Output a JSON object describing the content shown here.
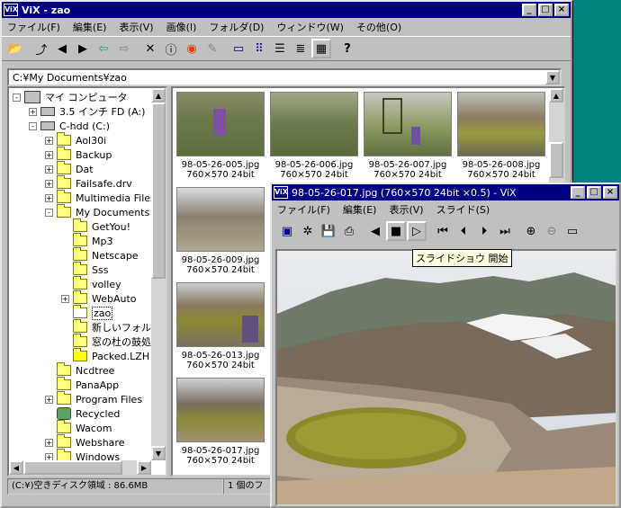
{
  "main_window": {
    "title": "ViX - zao",
    "app_icon": "ViX",
    "menu": [
      "ファイル(F)",
      "編集(E)",
      "表示(V)",
      "画像(I)",
      "フォルダ(D)",
      "ウィンドウ(W)",
      "その他(O)"
    ],
    "toolbar_icons": [
      "open-folder-icon",
      "up-folder-icon",
      "prev-icon",
      "next-icon",
      "back-icon",
      "forward-icon",
      "delete-icon",
      "info-icon",
      "color-icon",
      "tool-icon",
      "view-large-icon",
      "view-small-icon",
      "view-list-icon",
      "view-detail-icon",
      "view-thumbnail-icon",
      "help-icon"
    ],
    "path": "C:¥My Documents¥zao"
  },
  "tree": {
    "nodes": [
      {
        "label": "マイ コンピュータ",
        "level": 0,
        "expander": "-",
        "icon": "pc"
      },
      {
        "label": "3.5 インチ FD (A:)",
        "level": 1,
        "expander": "+",
        "icon": "drive"
      },
      {
        "label": "C-hdd (C:)",
        "level": 1,
        "expander": "-",
        "icon": "drive"
      },
      {
        "label": "Aol30i",
        "level": 2,
        "expander": "+",
        "icon": "folder"
      },
      {
        "label": "Backup",
        "level": 2,
        "expander": "+",
        "icon": "folder"
      },
      {
        "label": "Dat",
        "level": 2,
        "expander": "+",
        "icon": "folder"
      },
      {
        "label": "Failsafe.drv",
        "level": 2,
        "expander": "+",
        "icon": "folder"
      },
      {
        "label": "Multimedia Files",
        "level": 2,
        "expander": "+",
        "icon": "folder"
      },
      {
        "label": "My Documents",
        "level": 2,
        "expander": "-",
        "icon": "folder"
      },
      {
        "label": "GetYou!",
        "level": 3,
        "expander": "",
        "icon": "folder"
      },
      {
        "label": "Mp3",
        "level": 3,
        "expander": "",
        "icon": "folder"
      },
      {
        "label": "Netscape",
        "level": 3,
        "expander": "",
        "icon": "folder"
      },
      {
        "label": "Sss",
        "level": 3,
        "expander": "",
        "icon": "folder"
      },
      {
        "label": "volley",
        "level": 3,
        "expander": "",
        "icon": "folder"
      },
      {
        "label": "WebAuto",
        "level": 3,
        "expander": "+",
        "icon": "folder"
      },
      {
        "label": "zao",
        "level": 3,
        "expander": "",
        "icon": "folder-open",
        "selected": true
      },
      {
        "label": "新しいフォル",
        "level": 3,
        "expander": "",
        "icon": "folder"
      },
      {
        "label": "窓の杜の鼓処",
        "level": 3,
        "expander": "",
        "icon": "folder"
      },
      {
        "label": "Packed.LZH",
        "level": 3,
        "expander": "",
        "icon": "archive"
      },
      {
        "label": "Ncdtree",
        "level": 2,
        "expander": "",
        "icon": "folder"
      },
      {
        "label": "PanaApp",
        "level": 2,
        "expander": "",
        "icon": "folder"
      },
      {
        "label": "Program Files",
        "level": 2,
        "expander": "+",
        "icon": "folder"
      },
      {
        "label": "Recycled",
        "level": 2,
        "expander": "",
        "icon": "recycle"
      },
      {
        "label": "Wacom",
        "level": 2,
        "expander": "",
        "icon": "folder"
      },
      {
        "label": "Webshare",
        "level": 2,
        "expander": "+",
        "icon": "folder"
      },
      {
        "label": "Windows",
        "level": 2,
        "expander": "+",
        "icon": "folder"
      }
    ]
  },
  "thumbnails": [
    {
      "name": "98-05-26-005.jpg",
      "info": "760×570  24bit"
    },
    {
      "name": "98-05-26-006.jpg",
      "info": "760×570  24bit"
    },
    {
      "name": "98-05-26-007.jpg",
      "info": "760×570  24bit"
    },
    {
      "name": "98-05-26-008.jpg",
      "info": "760×570  24bit"
    },
    {
      "name": "98-05-26-009.jpg",
      "info": "760×570  24bit"
    },
    {
      "name": "98-05-26-013.jpg",
      "info": "760×570  24bit"
    },
    {
      "name": "98-05-26-017.jpg",
      "info": "760×570  24bit"
    }
  ],
  "status": {
    "disk": "(C:¥)空きディスク領域 : 86.6MB",
    "count": "1 個のフ"
  },
  "viewer": {
    "title": "98-05-26-017.jpg  (760×570 24bit  ×0.5) - ViX",
    "app_icon": "ViX",
    "menu": [
      "ファイル(F)",
      "編集(E)",
      "表示(V)",
      "スライド(S)"
    ],
    "toolbar_icons": [
      "fit-window-icon",
      "sparkle-icon",
      "save-icon",
      "print-icon",
      "slide-prev-icon",
      "slide-stop-icon",
      "slide-play-icon",
      "first-icon",
      "prev-icon",
      "next-icon",
      "last-icon",
      "zoom-in-icon",
      "zoom-out-icon",
      "fullscreen-icon"
    ],
    "tooltip": "スライドショウ 開始"
  }
}
